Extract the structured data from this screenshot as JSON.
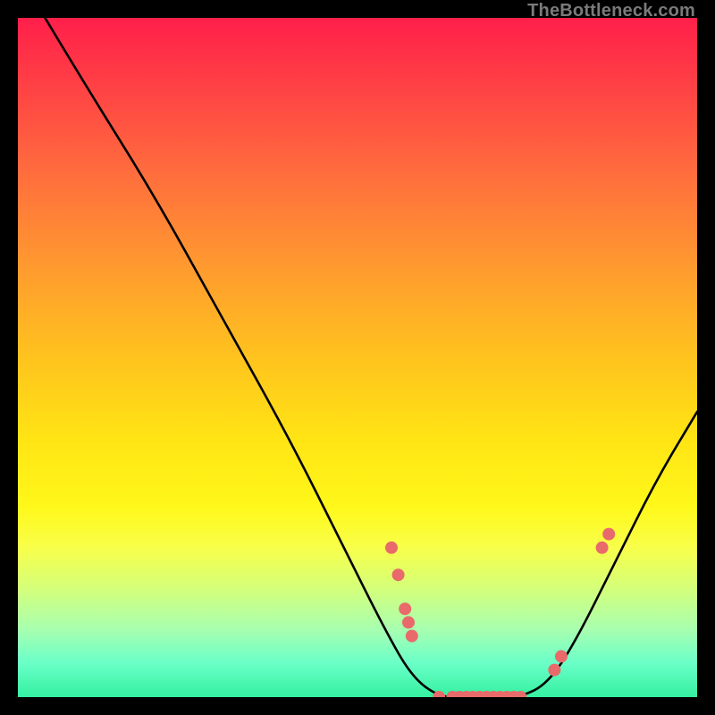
{
  "watermark": {
    "text": "TheBottleneck.com"
  },
  "chart_data": {
    "type": "line",
    "title": "",
    "xlabel": "",
    "ylabel": "",
    "xlim": [
      0,
      100
    ],
    "ylim": [
      0,
      100
    ],
    "curve": {
      "name": "bottleneck-curve",
      "points": [
        {
          "x": 4,
          "y": 100
        },
        {
          "x": 10,
          "y": 90
        },
        {
          "x": 20,
          "y": 74
        },
        {
          "x": 30,
          "y": 56
        },
        {
          "x": 40,
          "y": 38
        },
        {
          "x": 48,
          "y": 22
        },
        {
          "x": 54,
          "y": 10
        },
        {
          "x": 58,
          "y": 3
        },
        {
          "x": 62,
          "y": 0
        },
        {
          "x": 66,
          "y": 0
        },
        {
          "x": 70,
          "y": 0
        },
        {
          "x": 74,
          "y": 0
        },
        {
          "x": 78,
          "y": 2
        },
        {
          "x": 82,
          "y": 8
        },
        {
          "x": 88,
          "y": 20
        },
        {
          "x": 94,
          "y": 32
        },
        {
          "x": 100,
          "y": 42
        }
      ]
    },
    "markers": {
      "name": "sample-points",
      "color": "#e96a6a",
      "points": [
        {
          "x": 55,
          "y": 22
        },
        {
          "x": 56,
          "y": 18
        },
        {
          "x": 57,
          "y": 13
        },
        {
          "x": 57.5,
          "y": 11
        },
        {
          "x": 58,
          "y": 9
        },
        {
          "x": 62,
          "y": 0
        },
        {
          "x": 64,
          "y": 0
        },
        {
          "x": 65,
          "y": 0
        },
        {
          "x": 66,
          "y": 0
        },
        {
          "x": 67,
          "y": 0
        },
        {
          "x": 68,
          "y": 0
        },
        {
          "x": 69,
          "y": 0
        },
        {
          "x": 70,
          "y": 0
        },
        {
          "x": 71,
          "y": 0
        },
        {
          "x": 72,
          "y": 0
        },
        {
          "x": 73,
          "y": 0
        },
        {
          "x": 74,
          "y": 0
        },
        {
          "x": 79,
          "y": 4
        },
        {
          "x": 80,
          "y": 6
        },
        {
          "x": 86,
          "y": 22
        },
        {
          "x": 87,
          "y": 24
        }
      ]
    },
    "background": {
      "type": "vertical-gradient",
      "stops": [
        {
          "pos": 0,
          "color": "#ff1f4a"
        },
        {
          "pos": 50,
          "color": "#ffc31e"
        },
        {
          "pos": 78,
          "color": "#f8ff4a"
        },
        {
          "pos": 100,
          "color": "#34f0a0"
        }
      ]
    }
  }
}
